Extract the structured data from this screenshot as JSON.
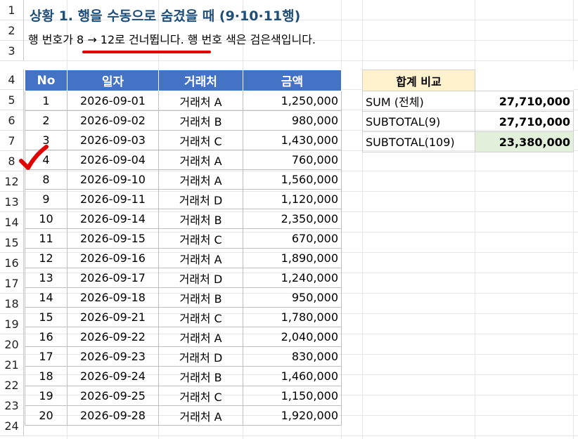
{
  "row_headers": [
    "1",
    "2",
    "3",
    "4",
    "5",
    "6",
    "7",
    "8",
    "12",
    "13",
    "14",
    "15",
    "16",
    "17",
    "18",
    "19",
    "20",
    "21",
    "22",
    "23",
    "24"
  ],
  "title": "상황 1. 행을 수동으로 숨겼을 때 (9·10·11행)",
  "subtitle": "행 번호가 8 → 12로 건너뜁니다. 행 번호 색은 검은색입니다.",
  "colors": {
    "header_blue": "#4472c4",
    "accent_red": "#e10000",
    "compare_header": "#fff2cc",
    "highlight_green": "#e2efda"
  },
  "data_table": {
    "headers": [
      "No",
      "일자",
      "거래처",
      "금액"
    ],
    "rows": [
      [
        "1",
        "2026-09-01",
        "거래처 A",
        "1,250,000"
      ],
      [
        "2",
        "2026-09-02",
        "거래처 B",
        "980,000"
      ],
      [
        "3",
        "2026-09-03",
        "거래처 C",
        "1,430,000"
      ],
      [
        "4",
        "2026-09-04",
        "거래처 A",
        "760,000"
      ],
      [
        "8",
        "2026-09-10",
        "거래처 A",
        "1,560,000"
      ],
      [
        "9",
        "2026-09-11",
        "거래처 D",
        "1,120,000"
      ],
      [
        "10",
        "2026-09-14",
        "거래처 B",
        "2,350,000"
      ],
      [
        "11",
        "2026-09-15",
        "거래처 C",
        "670,000"
      ],
      [
        "12",
        "2026-09-16",
        "거래처 A",
        "1,890,000"
      ],
      [
        "13",
        "2026-09-17",
        "거래처 D",
        "1,240,000"
      ],
      [
        "14",
        "2026-09-18",
        "거래처 B",
        "950,000"
      ],
      [
        "15",
        "2026-09-21",
        "거래처 C",
        "1,780,000"
      ],
      [
        "16",
        "2026-09-22",
        "거래처 A",
        "2,040,000"
      ],
      [
        "17",
        "2026-09-23",
        "거래처 D",
        "830,000"
      ],
      [
        "18",
        "2026-09-24",
        "거래처 B",
        "1,460,000"
      ],
      [
        "19",
        "2026-09-25",
        "거래처 C",
        "1,150,000"
      ],
      [
        "20",
        "2026-09-28",
        "거래처 A",
        "1,920,000"
      ]
    ]
  },
  "compare": {
    "title": "합계 비교",
    "rows": [
      {
        "label": "SUM (전체)",
        "value": "27,710,000"
      },
      {
        "label": "SUBTOTAL(9)",
        "value": "27,710,000"
      },
      {
        "label": "SUBTOTAL(109)",
        "value": "23,380,000"
      }
    ]
  },
  "icons": {
    "checkmark": "red-checkmark-icon"
  }
}
